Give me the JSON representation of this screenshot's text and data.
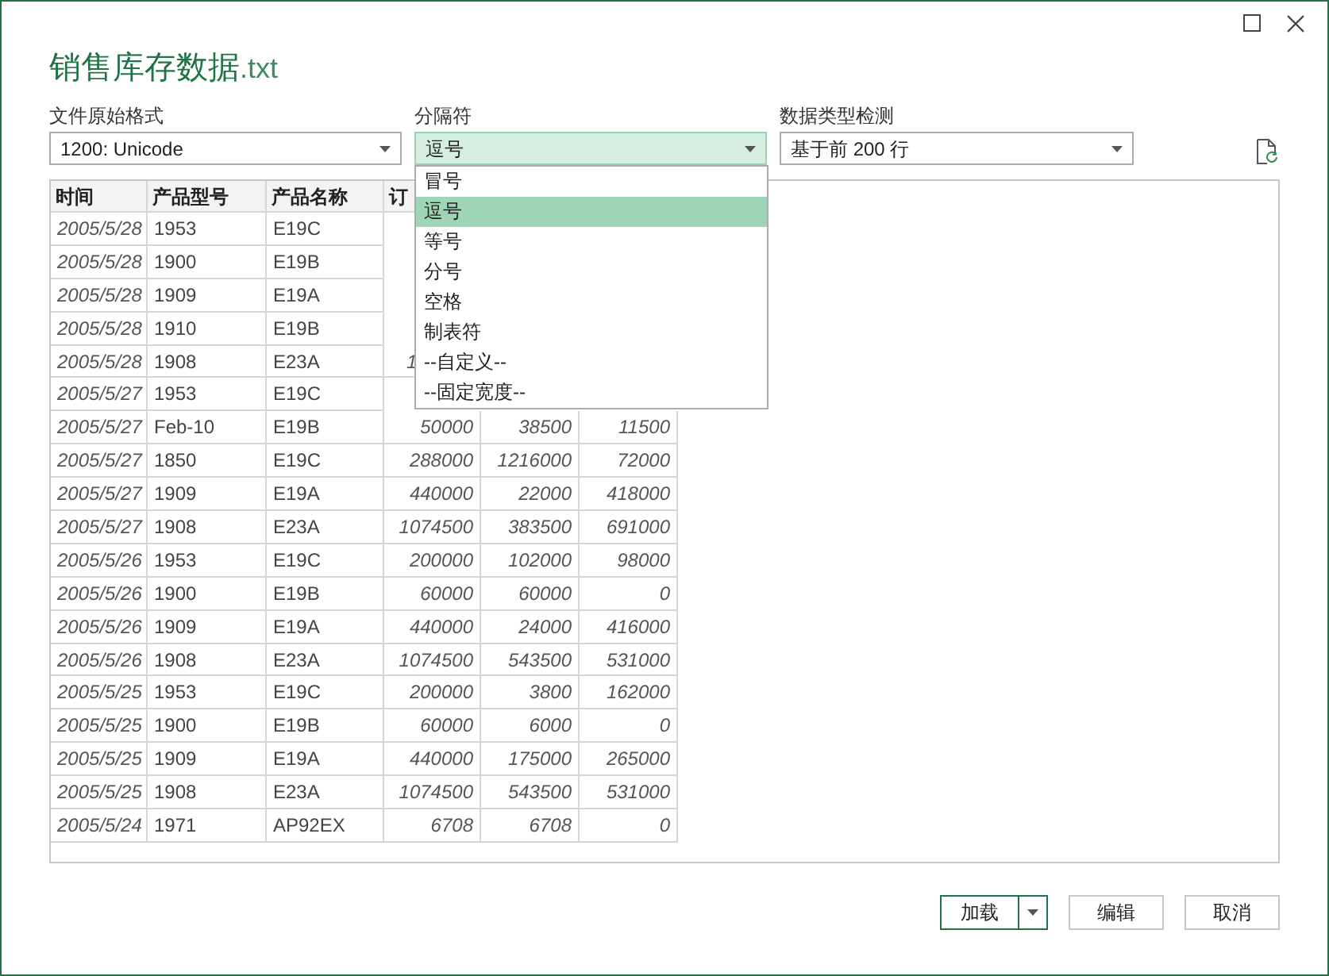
{
  "window": {
    "title_name": "销售库存数据",
    "title_ext": ".txt"
  },
  "fields": [
    {
      "label": "文件原始格式",
      "value": "1200: Unicode",
      "open": false
    },
    {
      "label": "分隔符",
      "value": "逗号",
      "open": true
    },
    {
      "label": "数据类型检测",
      "value": "基于前 200 行",
      "open": false
    }
  ],
  "delimiter_options": [
    {
      "label": "冒号",
      "selected": false
    },
    {
      "label": "逗号",
      "selected": true
    },
    {
      "label": "等号",
      "selected": false
    },
    {
      "label": "分号",
      "selected": false
    },
    {
      "label": "空格",
      "selected": false
    },
    {
      "label": "制表符",
      "selected": false
    },
    {
      "label": "--自定义--",
      "selected": false
    },
    {
      "label": "--固定宽度--",
      "selected": false
    }
  ],
  "table": {
    "columns": [
      "时间",
      "产品型号",
      "产品名称",
      "订"
    ],
    "rows": [
      [
        "2005/5/28",
        "1953",
        "E19C"
      ],
      [
        "2005/5/28",
        "1900",
        "E19B"
      ],
      [
        "2005/5/28",
        "1909",
        "E19A"
      ],
      [
        "2005/5/28",
        "1910",
        "E19B"
      ],
      [
        "2005/5/28",
        "1908",
        "E23A",
        "1"
      ],
      [
        "2005/5/27",
        "1953",
        "E19C"
      ],
      [
        "2005/5/27",
        "Feb-10",
        "E19B",
        "50000",
        "38500",
        "11500"
      ],
      [
        "2005/5/27",
        "1850",
        "E19C",
        "288000",
        "1216000",
        "72000"
      ],
      [
        "2005/5/27",
        "1909",
        "E19A",
        "440000",
        "22000",
        "418000"
      ],
      [
        "2005/5/27",
        "1908",
        "E23A",
        "1074500",
        "383500",
        "691000"
      ],
      [
        "2005/5/26",
        "1953",
        "E19C",
        "200000",
        "102000",
        "98000"
      ],
      [
        "2005/5/26",
        "1900",
        "E19B",
        "60000",
        "60000",
        "0"
      ],
      [
        "2005/5/26",
        "1909",
        "E19A",
        "440000",
        "24000",
        "416000"
      ],
      [
        "2005/5/26",
        "1908",
        "E23A",
        "1074500",
        "543500",
        "531000"
      ],
      [
        "2005/5/25",
        "1953",
        "E19C",
        "200000",
        "3800",
        "162000"
      ],
      [
        "2005/5/25",
        "1900",
        "E19B",
        "60000",
        "6000",
        "0"
      ],
      [
        "2005/5/25",
        "1909",
        "E19A",
        "440000",
        "175000",
        "265000"
      ],
      [
        "2005/5/25",
        "1908",
        "E23A",
        "1074500",
        "543500",
        "531000"
      ],
      [
        "2005/5/24",
        "1971",
        "AP92EX",
        "6708",
        "6708",
        "0"
      ]
    ]
  },
  "buttons": [
    {
      "label": "加载",
      "kind": "split"
    },
    {
      "label": "编辑",
      "kind": "plain"
    },
    {
      "label": "取消",
      "kind": "plain"
    }
  ]
}
